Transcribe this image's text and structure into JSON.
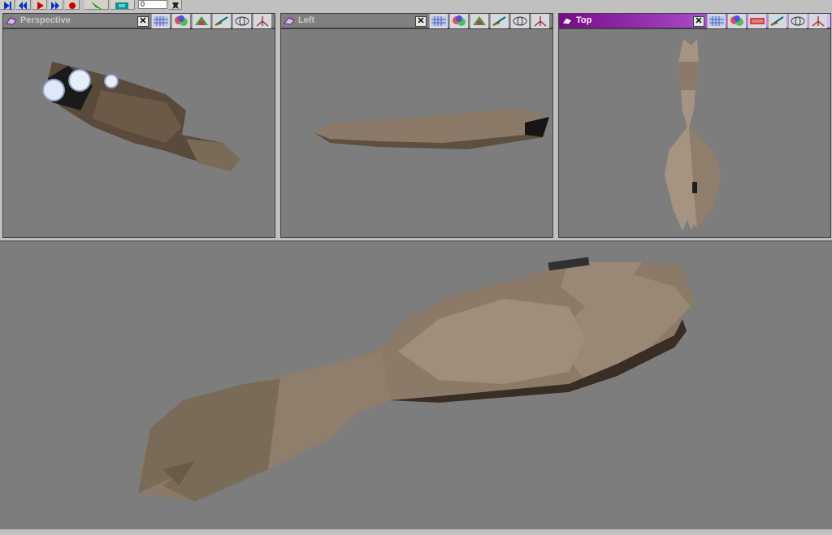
{
  "toolbar": {
    "buttons": [
      {
        "name": "first-frame-icon",
        "color": "#0033cc"
      },
      {
        "name": "prev-frame-icon",
        "color": "#0033cc"
      },
      {
        "name": "play-icon",
        "color": "#cc0000"
      },
      {
        "name": "next-frame-icon",
        "color": "#0033cc"
      },
      {
        "name": "record-icon",
        "color": "#cc0000"
      },
      {
        "name": "select-arrow-icon",
        "color": "#009900"
      },
      {
        "name": "refresh-icon",
        "color": "#009999"
      }
    ],
    "frame_value": "0"
  },
  "viewports": [
    {
      "id": "perspective",
      "label": "Perspective",
      "active": false
    },
    {
      "id": "left",
      "label": "Left",
      "active": false
    },
    {
      "id": "top",
      "label": "Top",
      "active": true
    }
  ],
  "viewport_tools": [
    "grid-icon",
    "shading-icon",
    "texture-icon",
    "pan-icon",
    "wireframe-icon",
    "zoom-icon"
  ],
  "close_label": "✕",
  "colors": {
    "ui_gray": "#c0c0c0",
    "viewport_bg": "#7d7d7d",
    "active_title": "#8a1aa0",
    "hull": "#8b7a68"
  }
}
